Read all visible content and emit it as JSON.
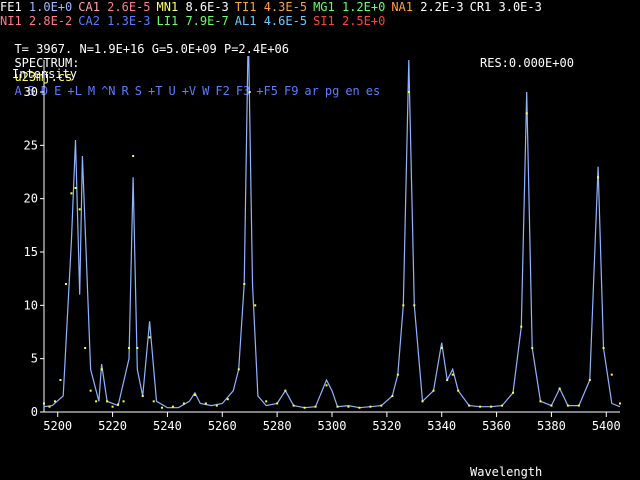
{
  "elements_row1": [
    {
      "name": "FE1",
      "value": "1.0E+0",
      "color": "#ffffff",
      "vcolor": "#9fb8ff"
    },
    {
      "name": "CA1",
      "value": "2.6E-5",
      "color": "#ff9fb0",
      "vcolor": "#ff7a8a"
    },
    {
      "name": "MN1",
      "value": "8.6E-3",
      "color": "#ffff66",
      "vcolor": "#ffffff"
    },
    {
      "name": "TI1",
      "value": "4.3E-5",
      "color": "#ff9f40",
      "vcolor": "#ff9f40"
    },
    {
      "name": "MG1",
      "value": "1.2E+0",
      "color": "#66ff66",
      "vcolor": "#66ff66"
    },
    {
      "name": "NA1",
      "value": "2.2E-3",
      "color": "#ff9f40",
      "vcolor": "#ffffff"
    },
    {
      "name": "CR1",
      "value": "3.0E-3",
      "color": "#ffffff",
      "vcolor": "#ffffff"
    }
  ],
  "elements_row2": [
    {
      "name": "NI1",
      "value": "2.8E-2",
      "color": "#ff7a8a",
      "vcolor": "#ff7a8a"
    },
    {
      "name": "CA2",
      "value": "1.3E-3",
      "color": "#5b7cff",
      "vcolor": "#5b7cff"
    },
    {
      "name": "LI1",
      "value": "7.9E-7",
      "color": "#66ff66",
      "vcolor": "#66ff66"
    },
    {
      "name": "AL1",
      "value": "4.6E-5",
      "color": "#66ccff",
      "vcolor": "#66ccff"
    },
    {
      "name": "SI1",
      "value": "2.5E+0",
      "color": "#ff4040",
      "vcolor": "#ff4040"
    }
  ],
  "params": {
    "text": "T= 3967. N=1.9E+16 G=5.0E+09 P=2.4E+06",
    "res": "RES:0.000E+00"
  },
  "spectrum": {
    "label": "SPECTRUM:",
    "file": "u23mj.cs",
    "menu": [
      "A",
      "B",
      "D",
      "E",
      "+L",
      "M",
      "^N",
      "R",
      "S",
      "+T",
      "U",
      "+V",
      "W",
      "F2",
      "F3",
      "+F5",
      "F9",
      "ar",
      "pg",
      "en",
      "es"
    ]
  },
  "colors": {
    "observed": "#ffff33",
    "synthetic": "#8fb4ff",
    "axes": "#ffffff",
    "header": "#ffffff"
  },
  "chart_data": {
    "type": "line",
    "ylabel": "Intensity",
    "xlabel": "Wavelength",
    "xlim": [
      5195,
      5405
    ],
    "ylim": [
      0,
      33
    ],
    "xticks": [
      5200,
      5220,
      5240,
      5260,
      5280,
      5300,
      5320,
      5340,
      5360,
      5380,
      5400
    ],
    "yticks": [
      0,
      5,
      10,
      15,
      20,
      25,
      30
    ],
    "series": [
      {
        "name": "",
        "style": "line",
        "x": [
          5195,
          5198,
          5202,
          5205,
          5206.5,
          5208,
          5209,
          5212,
          5215,
          5216,
          5218,
          5222,
          5226,
          5227.5,
          5229,
          5231,
          5233.5,
          5236,
          5240,
          5244,
          5248,
          5250,
          5252,
          5256,
          5260,
          5264,
          5266,
          5268,
          5269.5,
          5271,
          5273,
          5276,
          5280,
          5283,
          5286,
          5290,
          5294,
          5298,
          5300,
          5302,
          5306,
          5310,
          5314,
          5318,
          5322,
          5324,
          5326,
          5328,
          5330,
          5333,
          5337,
          5340,
          5342,
          5344,
          5346,
          5350,
          5354,
          5358,
          5362,
          5366,
          5369,
          5371,
          5373,
          5376,
          5380,
          5383,
          5386,
          5390,
          5394,
          5397,
          5399,
          5402,
          5405
        ],
        "y": [
          0.5,
          0.6,
          1.5,
          16,
          25.5,
          11,
          24,
          4,
          1,
          4.5,
          1,
          0.6,
          5,
          22,
          4,
          1.5,
          8.5,
          1,
          0.4,
          0.4,
          1,
          1.8,
          0.8,
          0.6,
          0.8,
          2,
          4,
          12,
          36,
          12,
          1.5,
          0.6,
          0.8,
          2,
          0.6,
          0.4,
          0.5,
          3,
          2,
          0.5,
          0.6,
          0.4,
          0.5,
          0.6,
          1.5,
          3.5,
          10,
          33,
          10,
          1,
          2,
          6.5,
          3,
          4,
          2,
          0.6,
          0.5,
          0.5,
          0.6,
          1.8,
          8,
          30,
          6,
          1,
          0.6,
          2.2,
          0.6,
          0.6,
          3,
          23,
          6,
          0.8,
          0.5
        ]
      },
      {
        "name": "",
        "style": "dots",
        "x": [
          5195,
          5197,
          5199,
          5201,
          5203,
          5205,
          5206.5,
          5208,
          5210,
          5212,
          5214,
          5216,
          5218,
          5220,
          5222,
          5224,
          5226,
          5227.5,
          5229,
          5231,
          5233.5,
          5235,
          5238,
          5242,
          5246,
          5250,
          5254,
          5258,
          5262,
          5266,
          5268,
          5270,
          5272,
          5276,
          5280,
          5283,
          5286,
          5290,
          5294,
          5298,
          5302,
          5306,
          5310,
          5314,
          5318,
          5322,
          5324,
          5326,
          5328,
          5330,
          5333,
          5337,
          5340,
          5342,
          5344,
          5346,
          5350,
          5354,
          5358,
          5362,
          5366,
          5369,
          5371,
          5373,
          5376,
          5380,
          5383,
          5386,
          5390,
          5394,
          5397,
          5399,
          5402,
          5405
        ],
        "y": [
          0.8,
          0.5,
          1,
          3,
          12,
          20.5,
          21,
          19,
          6,
          2,
          1,
          4,
          1,
          0.5,
          0.7,
          1,
          6,
          24,
          6,
          1.5,
          7,
          1,
          0.4,
          0.5,
          0.8,
          1.6,
          0.8,
          0.6,
          1.2,
          4,
          12,
          30,
          10,
          1,
          0.8,
          2,
          0.6,
          0.4,
          0.5,
          2.5,
          0.5,
          0.5,
          0.4,
          0.5,
          0.6,
          1.5,
          3.5,
          10,
          30,
          10,
          1,
          2,
          6,
          3,
          3.5,
          2,
          0.6,
          0.5,
          0.5,
          0.6,
          1.8,
          8,
          28,
          6,
          1,
          0.6,
          2.2,
          0.6,
          0.6,
          3,
          22,
          6,
          3.5,
          0.8
        ]
      }
    ]
  }
}
